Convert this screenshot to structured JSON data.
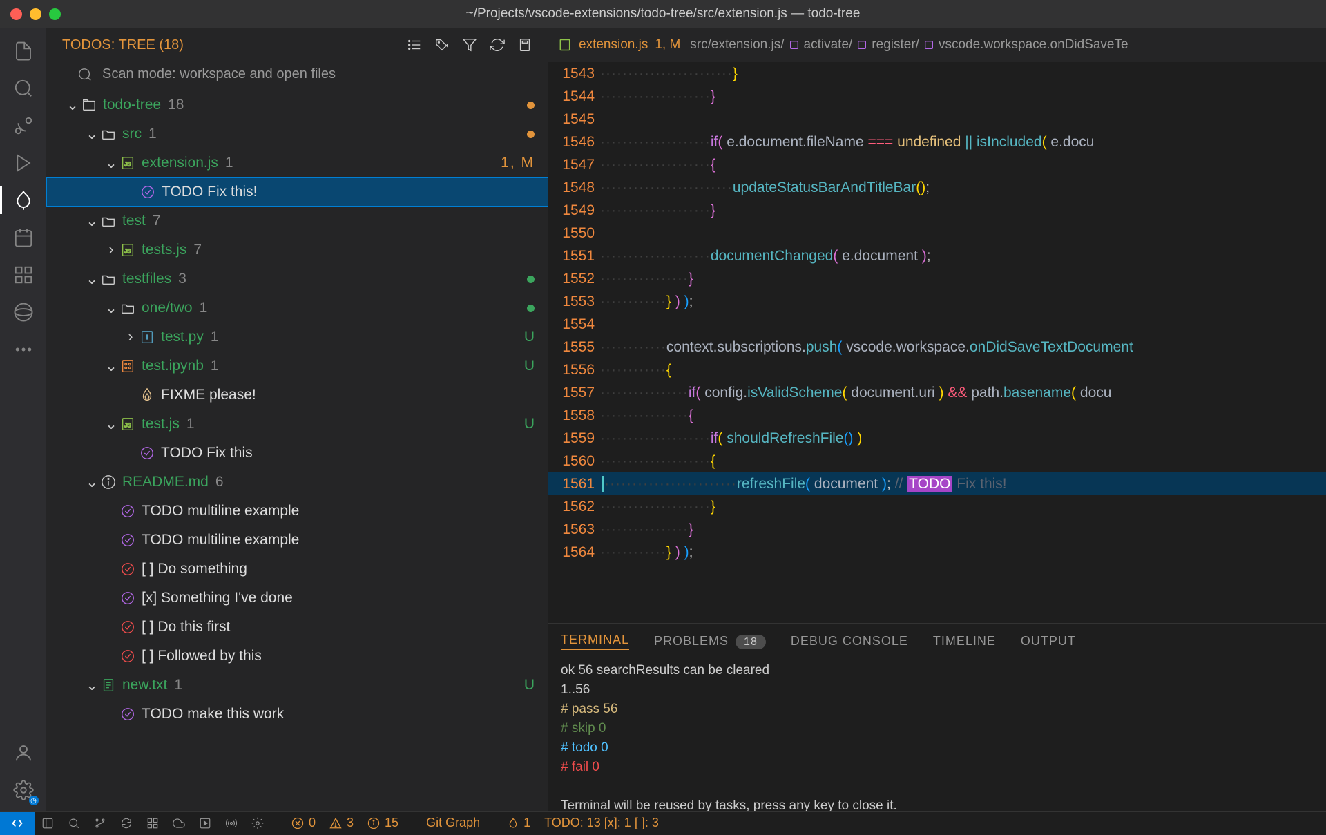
{
  "window": {
    "title": "~/Projects/vscode-extensions/todo-tree/src/extension.js — todo-tree"
  },
  "sidebar": {
    "title": "TODOS: TREE (18)",
    "scan": "Scan mode: workspace and open files",
    "tree": [
      {
        "indent": 0,
        "chev": "⌄",
        "icon": "folder-root",
        "label": "todo-tree",
        "count": "18",
        "right": "mdot"
      },
      {
        "indent": 1,
        "chev": "⌄",
        "icon": "folder",
        "label": "src",
        "count": "1",
        "right": "mdot"
      },
      {
        "indent": 2,
        "chev": "⌄",
        "icon": "js",
        "label": "extension.js",
        "count": "1",
        "right": "mod",
        "righttext": "1, M"
      },
      {
        "indent": 3,
        "sel": true,
        "icon": "todo-p",
        "labelw": "TODO Fix this!"
      },
      {
        "indent": 1,
        "chev": "⌄",
        "icon": "folder",
        "label": "test",
        "count": "7"
      },
      {
        "indent": 2,
        "chev": "›",
        "icon": "js",
        "label": "tests.js",
        "count": "7"
      },
      {
        "indent": 1,
        "chev": "⌄",
        "icon": "folder",
        "label": "testfiles",
        "count": "3",
        "right": "gdot"
      },
      {
        "indent": 2,
        "chev": "⌄",
        "icon": "folder",
        "label": "one/two",
        "count": "1",
        "right": "gdot"
      },
      {
        "indent": 3,
        "chev": "›",
        "icon": "py",
        "label": "test.py",
        "count": "1",
        "right": "badge",
        "righttext": "U"
      },
      {
        "indent": 2,
        "chev": "⌄",
        "icon": "ipynb",
        "label": "test.ipynb",
        "count": "1",
        "right": "badge",
        "righttext": "U"
      },
      {
        "indent": 3,
        "icon": "fixme",
        "labelw": "FIXME please!"
      },
      {
        "indent": 2,
        "chev": "⌄",
        "icon": "js",
        "label": "test.js",
        "count": "1",
        "right": "badge",
        "righttext": "U"
      },
      {
        "indent": 3,
        "icon": "todo-p",
        "labelw": "TODO Fix this"
      },
      {
        "indent": 1,
        "chev": "⌄",
        "icon": "info",
        "label": "README.md",
        "count": "6"
      },
      {
        "indent": 2,
        "icon": "todo-p",
        "labelw": "TODO multiline example"
      },
      {
        "indent": 2,
        "icon": "todo-p",
        "labelw": "TODO multiline example"
      },
      {
        "indent": 2,
        "icon": "todo-r",
        "labelw": "[ ] Do something"
      },
      {
        "indent": 2,
        "icon": "todo-p",
        "labelw": "[x] Something I've done"
      },
      {
        "indent": 2,
        "icon": "todo-r",
        "labelw": "[ ] Do this first"
      },
      {
        "indent": 2,
        "icon": "todo-r",
        "labelw": "[ ] Followed by this"
      },
      {
        "indent": 1,
        "chev": "⌄",
        "icon": "txt",
        "label": "new.txt",
        "count": "1",
        "right": "badge",
        "righttext": "U"
      },
      {
        "indent": 2,
        "icon": "todo-p",
        "labelw": "TODO make this work"
      }
    ]
  },
  "editor": {
    "tab": {
      "name": "extension.js",
      "badge": "1, M"
    },
    "crumbs": [
      "src/extension.js/",
      "activate/",
      "register/",
      "vscode.workspace.onDidSaveTe"
    ],
    "lines": [
      {
        "n": "1543",
        "ws": 24,
        "html": "<span class='brace'>}</span>"
      },
      {
        "n": "1544",
        "ws": 20,
        "html": "<span class='brace2'>}</span>"
      },
      {
        "n": "1545",
        "ws": 0,
        "html": ""
      },
      {
        "n": "1546",
        "ws": 20,
        "html": "<span class='kw'>if</span><span class='brace2'>(</span> <span class='var'>e.document.fileName</span> <span class='opred'>===</span> <span class='und'>undefined</span> <span class='op'>||</span> <span class='fn'>isIncluded</span><span class='brace'>(</span> <span class='var'>e.docu</span>"
      },
      {
        "n": "1547",
        "ws": 20,
        "html": "<span class='brace2'>{</span>"
      },
      {
        "n": "1548",
        "ws": 24,
        "html": "<span class='fn'>updateStatusBarAndTitleBar</span><span class='brace'>()</span>;"
      },
      {
        "n": "1549",
        "ws": 20,
        "html": "<span class='brace2'>}</span>"
      },
      {
        "n": "1550",
        "ws": 0,
        "html": ""
      },
      {
        "n": "1551",
        "ws": 20,
        "html": "<span class='fn'>documentChanged</span><span class='brace2'>(</span> <span class='var'>e.document</span> <span class='brace2'>)</span>;"
      },
      {
        "n": "1552",
        "ws": 16,
        "html": "<span class='brace2'>}</span>"
      },
      {
        "n": "1553",
        "ws": 12,
        "html": "<span class='brace'>}</span> <span class='brace2'>)</span> <span class='brace3'>)</span>;"
      },
      {
        "n": "1554",
        "ws": 0,
        "html": ""
      },
      {
        "n": "1555",
        "ws": 12,
        "html": "<span class='var'>context.subscriptions.</span><span class='fn'>push</span><span class='brace3'>(</span> <span class='var'>vscode.workspace.</span><span class='fn'>onDidSaveTextDocument</span>"
      },
      {
        "n": "1556",
        "ws": 12,
        "html": "<span class='brace'>{</span>"
      },
      {
        "n": "1557",
        "ws": 16,
        "html": "<span class='kw'>if</span><span class='brace2'>(</span> <span class='var'>config.</span><span class='fn'>isValidScheme</span><span class='brace'>(</span> <span class='var'>document.uri</span> <span class='brace'>)</span> <span class='opred'>&amp;&amp;</span> <span class='var'>path.</span><span class='fn'>basename</span><span class='brace'>(</span> <span class='var'>docu</span>"
      },
      {
        "n": "1558",
        "ws": 16,
        "html": "<span class='brace2'>{</span>"
      },
      {
        "n": "1559",
        "ws": 20,
        "html": "<span class='kw'>if</span><span class='brace'>(</span> <span class='fn'>shouldRefreshFile</span><span class='brace3'>()</span> <span class='brace'>)</span>"
      },
      {
        "n": "1560",
        "ws": 20,
        "html": "<span class='brace'>{</span>"
      },
      {
        "n": "1561",
        "ws": 24,
        "hl": true,
        "html": "<span class='fn'>refreshFile</span><span class='brace3'>(</span> <span class='var'>document</span> <span class='brace3'>)</span>; <span class='cm'>// </span><span class='todo-hl'>TODO</span> <span class='cm'>Fix this!</span>"
      },
      {
        "n": "1562",
        "ws": 20,
        "html": "<span class='brace'>}</span>"
      },
      {
        "n": "1563",
        "ws": 16,
        "html": "<span class='brace2'>}</span>"
      },
      {
        "n": "1564",
        "ws": 12,
        "html": "<span class='brace'>}</span> <span class='brace2'>)</span> <span class='brace3'>)</span>;"
      }
    ]
  },
  "panel": {
    "tabs": {
      "terminal": "TERMINAL",
      "problems": "PROBLEMS",
      "pbadge": "18",
      "debug": "DEBUG CONSOLE",
      "timeline": "TIMELINE",
      "output": "OUTPUT"
    },
    "term": [
      {
        "c": "w",
        "t": "ok 56 searchResults can be cleared"
      },
      {
        "c": "w",
        "t": "1..56"
      },
      {
        "c": "y",
        "t": "# pass 56"
      },
      {
        "c": "g",
        "t": "# skip 0"
      },
      {
        "c": "b",
        "t": "# todo 0"
      },
      {
        "c": "r",
        "t": "# fail 0"
      },
      {
        "c": "w",
        "t": ""
      },
      {
        "c": "w",
        "t": "Terminal will be reused by tasks, press any key to close it."
      }
    ]
  },
  "status": {
    "err": "0",
    "warn": "3",
    "info": "15",
    "gitgraph": "Git Graph",
    "flame": "1",
    "todo": "TODO: 13  [x]: 1  [ ]: 3"
  },
  "colors": {
    "red": "#ff5f56",
    "yellow": "#ffbd2e",
    "green": "#27c93f"
  }
}
